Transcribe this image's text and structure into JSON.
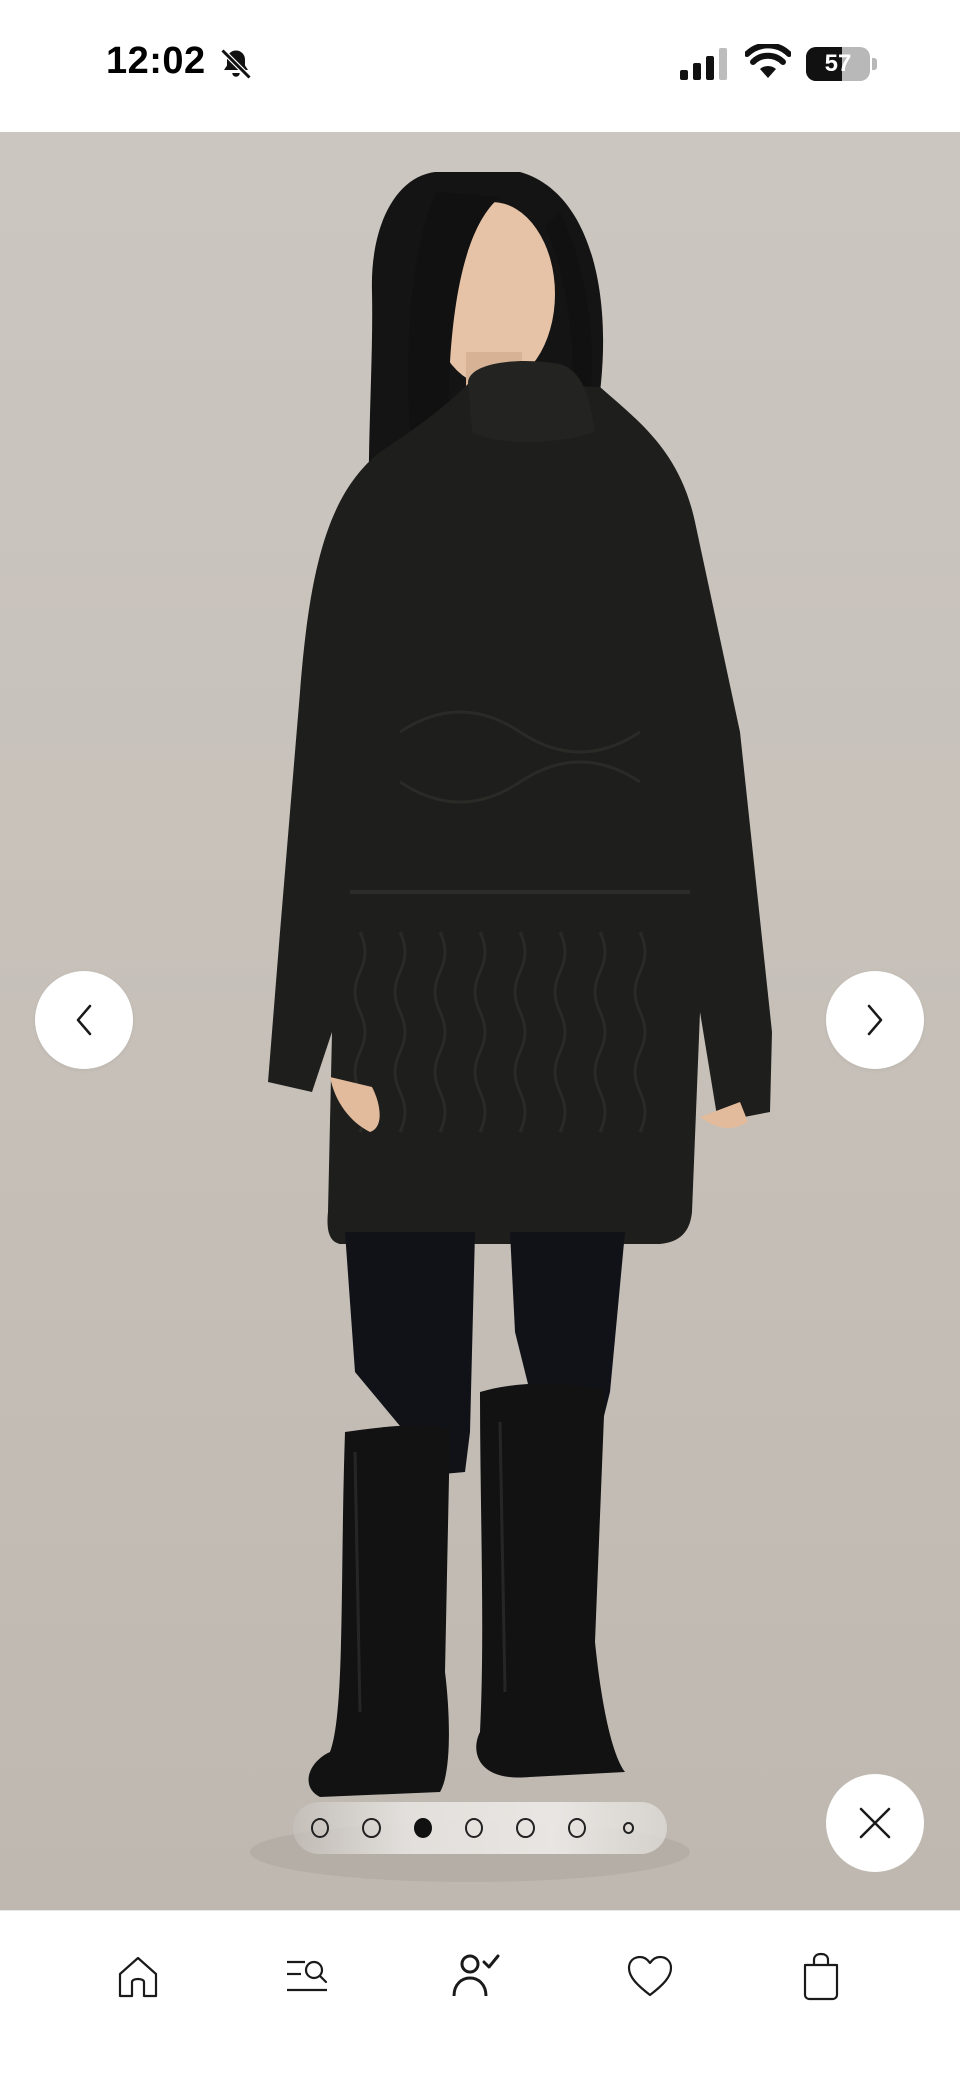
{
  "status_bar": {
    "time": "12:02",
    "battery_level": 57,
    "battery_label": "57",
    "icons": [
      "bell-slash-icon",
      "signal-bars-icon",
      "wifi-icon",
      "battery-icon"
    ]
  },
  "gallery": {
    "total_images": 7,
    "active_index": 2,
    "icons": {
      "prev": "chevron-left-icon",
      "next": "chevron-right-icon",
      "close": "close-icon"
    }
  },
  "bottom_nav": {
    "tabs": [
      {
        "id": "home",
        "icon": "home-icon"
      },
      {
        "id": "search",
        "icon": "search-list-icon"
      },
      {
        "id": "account",
        "icon": "user-check-icon"
      },
      {
        "id": "favorites",
        "icon": "heart-icon"
      },
      {
        "id": "bag",
        "icon": "shopping-bag-icon"
      }
    ]
  },
  "colors": {
    "background": "#ffffff",
    "stage": "#c8c2bb",
    "sweater": "#1d1d1b",
    "icon": "#1a1a1a"
  }
}
